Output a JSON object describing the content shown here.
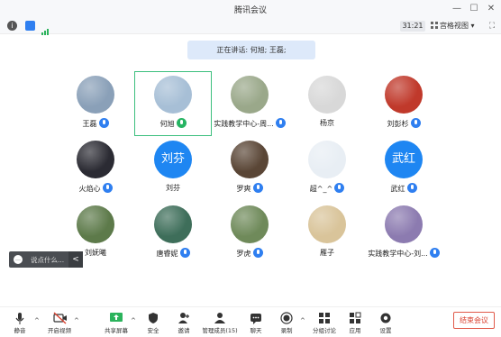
{
  "window": {
    "title": "腾讯会议",
    "min": "—",
    "max": "☐",
    "close": "✕"
  },
  "infobar": {
    "timer": "31:21",
    "view_label": "宫格视图"
  },
  "speaking": {
    "text": "正在讲话: 何旭; 王磊;"
  },
  "participants": [
    {
      "name": "王磊",
      "mic": "blue",
      "avatar": "photo",
      "color": "#8aa0b8"
    },
    {
      "name": "何旭",
      "mic": "green",
      "avatar": "photo",
      "color": "#a7bfd6",
      "active": true
    },
    {
      "name": "实践教学中心-周...",
      "mic": "blue",
      "avatar": "photo",
      "color": "#9aa88a"
    },
    {
      "name": "杨京",
      "mic": "none",
      "avatar": "photo",
      "color": "#d8d8d8"
    },
    {
      "name": "刘彭杉",
      "mic": "blue",
      "avatar": "photo",
      "color": "#c0392b"
    },
    {
      "name": "火焰心",
      "mic": "blue",
      "avatar": "photo",
      "color": "#2b2b33"
    },
    {
      "name": "刘芬",
      "mic": "none",
      "avatar": "text",
      "initials": "刘芬"
    },
    {
      "name": "罗爽",
      "mic": "blue",
      "avatar": "photo",
      "color": "#5a4636"
    },
    {
      "name": "超^_^",
      "mic": "blue",
      "avatar": "photo",
      "color": "#e8eef4"
    },
    {
      "name": "武红",
      "mic": "blue",
      "avatar": "text",
      "initials": "武红"
    },
    {
      "name": "刘妩曦",
      "mic": "none",
      "avatar": "photo",
      "color": "#5d7a4a"
    },
    {
      "name": "唐睿妮",
      "mic": "blue",
      "avatar": "photo",
      "color": "#3e6e5a"
    },
    {
      "name": "罗虎",
      "mic": "blue",
      "avatar": "photo",
      "color": "#6f8a5a"
    },
    {
      "name": "雁子",
      "mic": "none",
      "avatar": "photo",
      "color": "#d9c49a"
    },
    {
      "name": "实践教学中心-刘...",
      "mic": "blue",
      "avatar": "photo",
      "color": "#8c7bb0"
    }
  ],
  "chatbar": {
    "icon": "…",
    "placeholder": "说点什么...",
    "collapse": "<"
  },
  "toolbar": {
    "mute": "静音",
    "video": "开启视频",
    "share": "共享屏幕",
    "security": "安全",
    "invite": "邀请",
    "members": "管理成员(15)",
    "chat": "聊天",
    "record": "录制",
    "breakout": "分组讨论",
    "apps": "应用",
    "settings": "设置",
    "end": "结束会议"
  },
  "colors": {
    "accent": "#1e86f2",
    "active_border": "#3cbf7e",
    "end": "#d9412f"
  }
}
